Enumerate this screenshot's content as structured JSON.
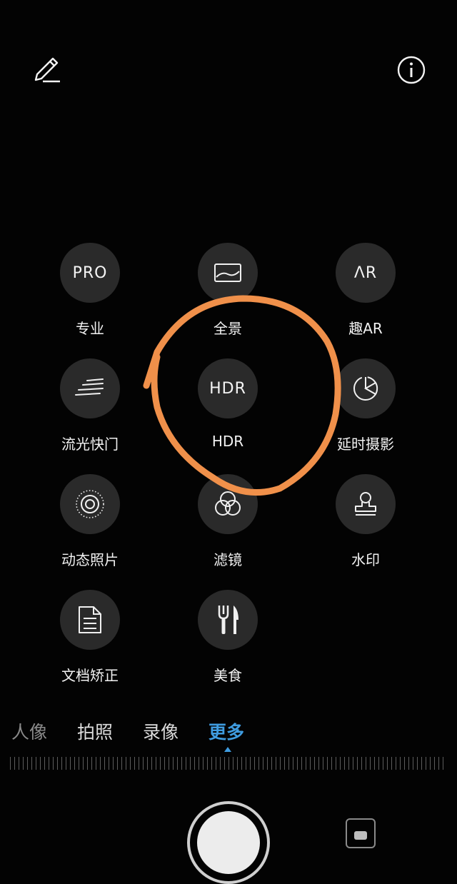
{
  "topbar": {
    "edit_icon": "pencil-icon",
    "info_icon": "info-icon"
  },
  "modes": [
    {
      "id": "pro",
      "icon": "pro-icon",
      "icon_text": "PRO",
      "label": "专业"
    },
    {
      "id": "panorama",
      "icon": "panorama-icon",
      "label": "全景"
    },
    {
      "id": "ar",
      "icon": "ar-icon",
      "icon_text": "ΛR",
      "label": "趣AR"
    },
    {
      "id": "light-painting",
      "icon": "light-streaks-icon",
      "label": "流光快门"
    },
    {
      "id": "hdr",
      "icon": "hdr-icon",
      "icon_text": "HDR",
      "label": "HDR"
    },
    {
      "id": "time-lapse",
      "icon": "time-lapse-icon",
      "label": "延时摄影"
    },
    {
      "id": "moving-picture",
      "icon": "live-photo-icon",
      "label": "动态照片"
    },
    {
      "id": "filter",
      "icon": "filter-icon",
      "label": "滤镜"
    },
    {
      "id": "watermark",
      "icon": "stamp-icon",
      "label": "水印"
    },
    {
      "id": "document",
      "icon": "document-icon",
      "label": "文档矫正"
    },
    {
      "id": "food",
      "icon": "fork-knife-icon",
      "label": "美食"
    }
  ],
  "tabs": [
    {
      "label": "人像",
      "state": "faded"
    },
    {
      "label": "拍照",
      "state": "normal"
    },
    {
      "label": "录像",
      "state": "normal"
    },
    {
      "label": "更多",
      "state": "active"
    }
  ],
  "colors": {
    "background": "#030303",
    "button": "#2a2a2a",
    "active_tab": "#3f9ce0",
    "annotation": "#f0904a"
  },
  "annotation": {
    "shape": "hand-drawn circle around HDR",
    "color": "#f0904a"
  }
}
